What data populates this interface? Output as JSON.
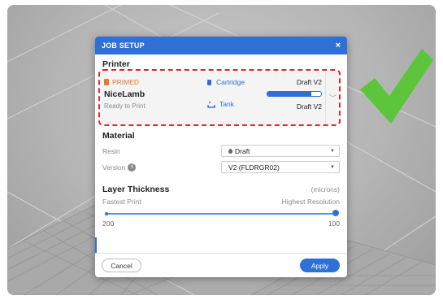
{
  "dialog": {
    "title": "JOB SETUP",
    "close_glyph": "×"
  },
  "printer": {
    "section_title": "Printer",
    "status_label": "PRIMED",
    "name": "NiceLamb",
    "state": "Ready to Print",
    "cartridge_label": "Cartridge",
    "cartridge_value": "Draft V2",
    "cartridge_fill_fraction": 0.82,
    "tank_label": "Tank",
    "tank_value": "Draft V2",
    "expand_icon": "chevron-down-icon",
    "status_color": "#e07a2e"
  },
  "material": {
    "section_title": "Material",
    "resin_label": "Resin",
    "resin_value": "Draft",
    "version_label": "Version",
    "version_value": "V2 (FLDRGR02)"
  },
  "layer": {
    "section_title": "Layer Thickness",
    "unit": "(microns)",
    "left_hint": "Fastest Print",
    "right_hint": "Highest Resolution",
    "min_label": "200",
    "max_label": "100",
    "selected_fraction": 1.0
  },
  "footer": {
    "cancel_label": "Cancel",
    "apply_label": "Apply"
  },
  "colors": {
    "accent": "#2f6fd6",
    "annotation_dash": "#e0252b",
    "checkmark": "#5cc53b"
  }
}
